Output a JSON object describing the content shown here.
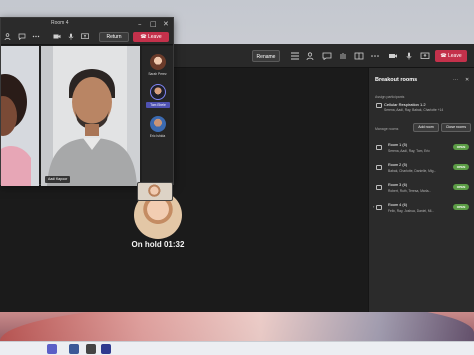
{
  "room_window": {
    "title": "Room 4",
    "return_label": "Return",
    "leave_label": "Leave",
    "tiles": [
      {
        "name": ""
      },
      {
        "name": "Aadi Kapoor"
      }
    ],
    "roster": [
      {
        "name": "Sarah Perez",
        "highlighted": false
      },
      {
        "name": "Tom Ebele",
        "highlighted": true
      },
      {
        "name": "Eric Ishida",
        "highlighted": false
      }
    ]
  },
  "main_window": {
    "rename_label": "Rename",
    "leave_label": "Leave",
    "on_hold_text": "On hold 01:32"
  },
  "breakout_panel": {
    "title": "Breakout rooms",
    "assignments_label": "Assign participants",
    "topic": {
      "title": "Cellular Respiration 1.2",
      "participants": "Serena, Aadi, Ray, Babak, Charlotte +14"
    },
    "managed_label": "Manage rooms",
    "add_room_label": "Add room",
    "close_rooms_label": "Close rooms",
    "rooms": [
      {
        "name": "Room 1 (5)",
        "participants": "Serena, Aadi, Ray, Tom, Eric",
        "status": "OPEN"
      },
      {
        "name": "Room 2 (5)",
        "participants": "Babak, Charlotte, Danielle, Mig...",
        "status": "OPEN"
      },
      {
        "name": "Room 3 (6)",
        "participants": "Robert, Ruth, Teresa, Marla...",
        "status": "OPEN"
      },
      {
        "name": "Room 4 (6)",
        "participants": "Felix, Ray, Joshua, Daniel, Mi...",
        "status": "OPEN"
      }
    ]
  },
  "colors": {
    "leave_red": "#c4314b",
    "open_green": "#5b9c45",
    "highlight_purple": "#4f52b2"
  }
}
